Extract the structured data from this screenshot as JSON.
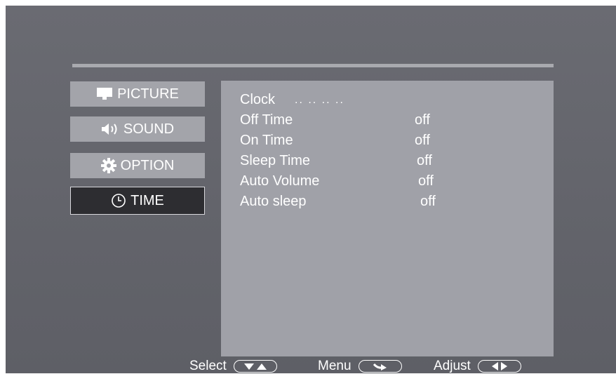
{
  "menu": {
    "items": [
      {
        "label": "PICTURE",
        "icon": "monitor-icon"
      },
      {
        "label": "SOUND",
        "icon": "speaker-icon"
      },
      {
        "label": "OPTION",
        "icon": "gear-icon"
      },
      {
        "label": "TIME",
        "icon": "clock-icon",
        "selected": true
      }
    ]
  },
  "time_settings": {
    "clock": {
      "label": "Clock",
      "value": "..   ..   ..   .."
    },
    "rows": [
      {
        "label": "Off Time",
        "value": "off"
      },
      {
        "label": "On Time",
        "value": "off"
      },
      {
        "label": "Sleep Time",
        "value": "off"
      },
      {
        "label": "Auto Volume",
        "value": "off"
      },
      {
        "label": "Auto sleep",
        "value": "off"
      }
    ]
  },
  "footer": {
    "select_label": "Select",
    "menu_label": "Menu",
    "adjust_label": "Adjust"
  },
  "colors": {
    "background": "#65666d",
    "panel": "#a0a1a8",
    "menu_item": "#a3a4aa",
    "menu_item_selected": "#2d2d31",
    "text": "#ffffff"
  }
}
